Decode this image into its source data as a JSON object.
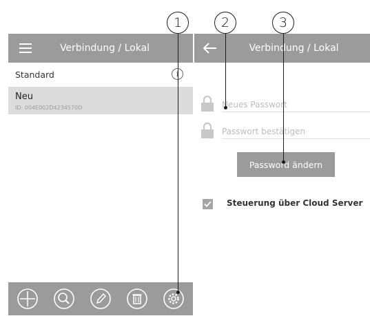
{
  "callouts": [
    "1",
    "2",
    "3"
  ],
  "left_screen": {
    "appbar_title": "Verbindung / Lokal",
    "menu_icon": "hamburger-menu-icon",
    "list": [
      {
        "name": "Standard",
        "icon": "info-icon",
        "info_glyph": "i"
      },
      {
        "name": "Neu",
        "id": "ID: 004E002D4234570D"
      }
    ],
    "toolbar_icons": [
      "add-icon",
      "search-icon",
      "edit-icon",
      "delete-icon",
      "settings-icon"
    ]
  },
  "right_screen": {
    "appbar_title": "Verbindung / Lokal",
    "back_icon": "back-arrow-icon",
    "new_password_placeholder": "Neues Passwort",
    "confirm_password_placeholder": "Passwort bestätigen",
    "change_button_label": "Password ändern",
    "cloud_checkbox_label": "Steuerung über Cloud Server",
    "cloud_checkbox_checked": true
  },
  "colors": {
    "bar_gray": "#9b9b9b",
    "selected_row": "#dcdcdc",
    "checkbox_gray": "#a5a5a5"
  }
}
